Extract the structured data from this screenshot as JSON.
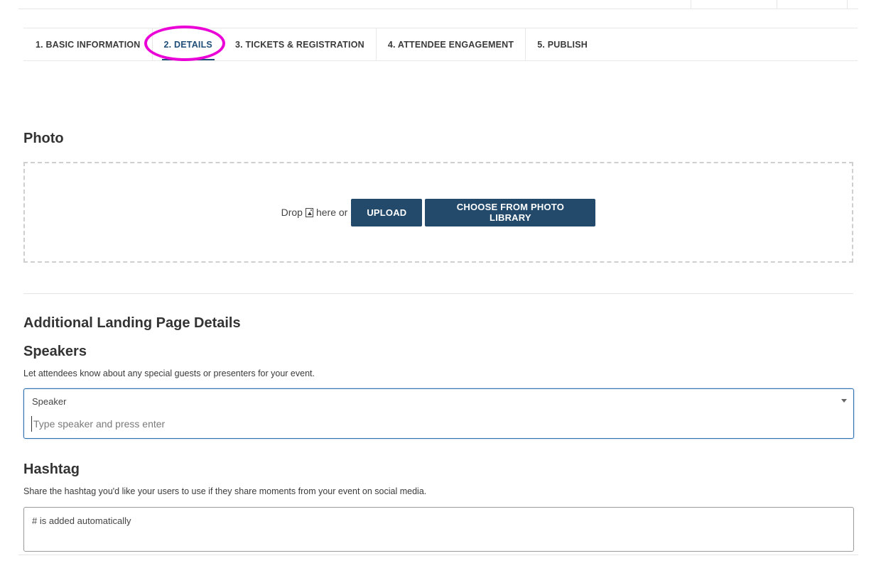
{
  "tabs": [
    {
      "label": "1. BASIC INFORMATION",
      "active": false
    },
    {
      "label": "2. DETAILS",
      "active": true
    },
    {
      "label": "3. TICKETS & REGISTRATION",
      "active": false
    },
    {
      "label": "4. ATTENDEE ENGAGEMENT",
      "active": false
    },
    {
      "label": "5. PUBLISH",
      "active": false
    }
  ],
  "photo": {
    "heading": "Photo",
    "drop_prefix": "Drop",
    "drop_suffix": "here or",
    "upload_label": "UPLOAD",
    "library_label": "CHOOSE FROM PHOTO LIBRARY"
  },
  "additional": {
    "heading": "Additional Landing Page Details"
  },
  "speakers": {
    "heading": "Speakers",
    "description": "Let attendees know about any special guests or presenters for your event.",
    "field_label": "Speaker",
    "placeholder": "Type speaker and press enter"
  },
  "hashtag": {
    "heading": "Hashtag",
    "description": "Share the hashtag you'd like your users to use if they share moments from your event on social media.",
    "placeholder": "# is added automatically"
  },
  "colors": {
    "accent": "#1f4e79",
    "button": "#234a6b",
    "highlight": "#ea00d6"
  }
}
